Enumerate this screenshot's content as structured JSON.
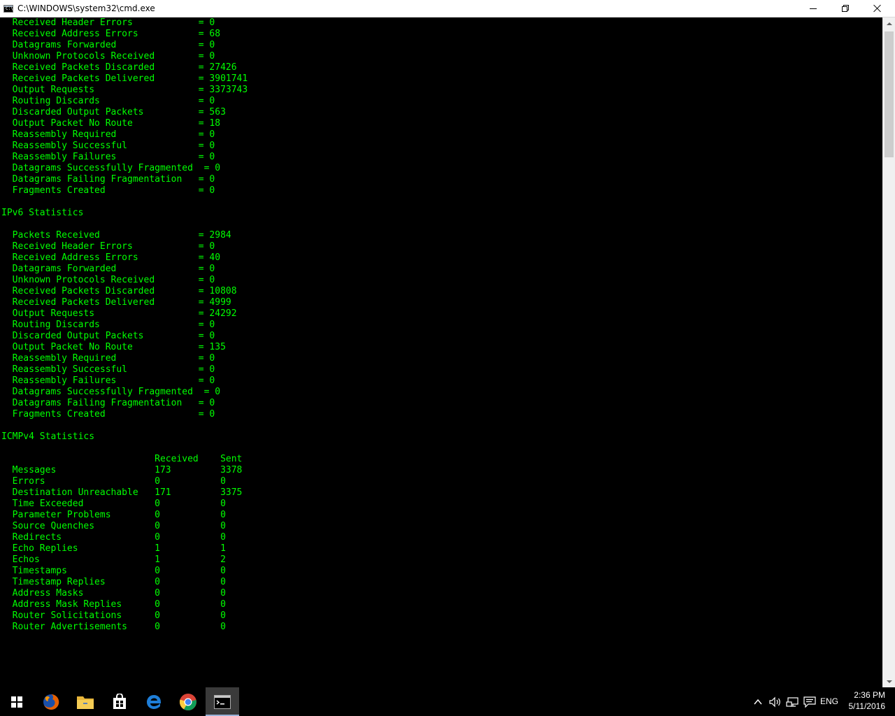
{
  "window": {
    "title": "C:\\WINDOWS\\system32\\cmd.exe",
    "icon_label": "C:\\"
  },
  "console": {
    "text_color": "#00ff00",
    "lines": [
      "  Received Header Errors            = 0",
      "  Received Address Errors           = 68",
      "  Datagrams Forwarded               = 0",
      "  Unknown Protocols Received        = 0",
      "  Received Packets Discarded        = 27426",
      "  Received Packets Delivered        = 3901741",
      "  Output Requests                   = 3373743",
      "  Routing Discards                  = 0",
      "  Discarded Output Packets          = 563",
      "  Output Packet No Route            = 18",
      "  Reassembly Required               = 0",
      "  Reassembly Successful             = 0",
      "  Reassembly Failures               = 0",
      "  Datagrams Successfully Fragmented  = 0",
      "  Datagrams Failing Fragmentation   = 0",
      "  Fragments Created                 = 0",
      "",
      "IPv6 Statistics",
      "",
      "  Packets Received                  = 2984",
      "  Received Header Errors            = 0",
      "  Received Address Errors           = 40",
      "  Datagrams Forwarded               = 0",
      "  Unknown Protocols Received        = 0",
      "  Received Packets Discarded        = 10808",
      "  Received Packets Delivered        = 4999",
      "  Output Requests                   = 24292",
      "  Routing Discards                  = 0",
      "  Discarded Output Packets          = 0",
      "  Output Packet No Route            = 135",
      "  Reassembly Required               = 0",
      "  Reassembly Successful             = 0",
      "  Reassembly Failures               = 0",
      "  Datagrams Successfully Fragmented  = 0",
      "  Datagrams Failing Fragmentation   = 0",
      "  Fragments Created                 = 0",
      "",
      "ICMPv4 Statistics",
      "",
      "                            Received    Sent",
      "  Messages                  173         3378",
      "  Errors                    0           0",
      "  Destination Unreachable   171         3375",
      "  Time Exceeded             0           0",
      "  Parameter Problems        0           0",
      "  Source Quenches           0           0",
      "  Redirects                 0           0",
      "  Echo Replies              1           1",
      "  Echos                     1           2",
      "  Timestamps                0           0",
      "  Timestamp Replies         0           0",
      "  Address Masks             0           0",
      "  Address Mask Replies      0           0",
      "  Router Solicitations      0           0",
      "  Router Advertisements     0           0"
    ]
  },
  "taskbar": {
    "items": [
      {
        "name": "start-button",
        "icon": "windows-logo-icon"
      },
      {
        "name": "firefox-taskbar-item",
        "icon": "firefox-icon"
      },
      {
        "name": "file-explorer-taskbar-item",
        "icon": "folder-icon"
      },
      {
        "name": "store-taskbar-item",
        "icon": "store-bag-icon"
      },
      {
        "name": "edge-taskbar-item",
        "icon": "edge-icon"
      },
      {
        "name": "chrome-taskbar-item",
        "icon": "chrome-icon"
      },
      {
        "name": "cmd-taskbar-item",
        "icon": "cmd-icon",
        "active": true
      }
    ],
    "tray": {
      "language": "ENG",
      "time": "2:36 PM",
      "date": "5/11/2016"
    }
  }
}
